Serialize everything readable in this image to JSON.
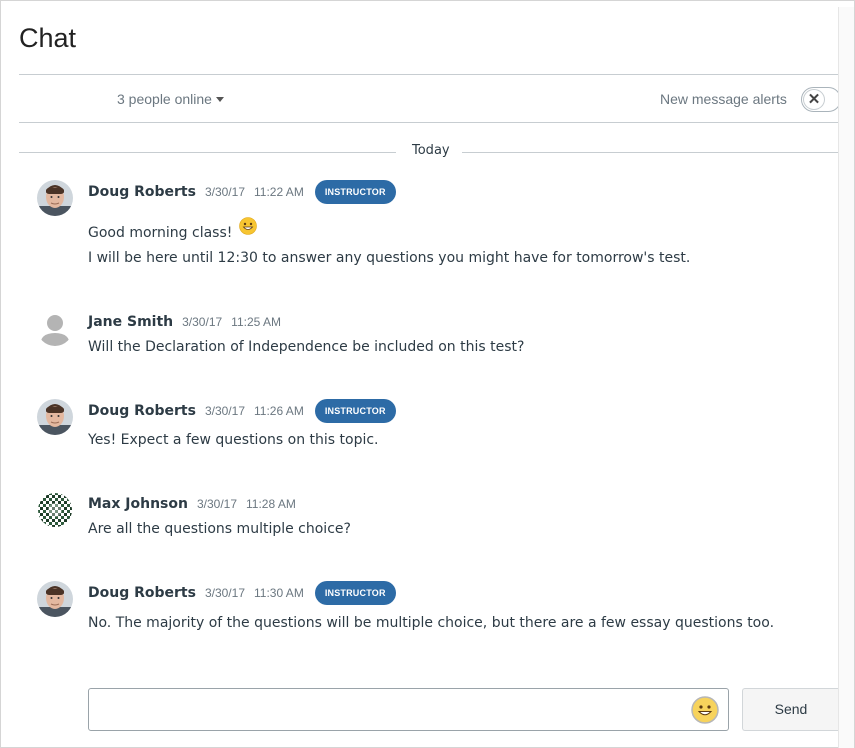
{
  "header": {
    "title": "Chat",
    "online_label": "3 people online",
    "alerts_label": "New message alerts",
    "alerts_toggle_symbol": "✕"
  },
  "divider": {
    "label": "Today"
  },
  "messages": [
    {
      "author": "Doug Roberts",
      "date": "3/30/17",
      "time": "11:22 AM",
      "badge": "INSTRUCTOR",
      "avatar": "photo-avatar",
      "lines": [
        "Good morning class!",
        "I will be here until 12:30 to answer any questions you might have for tomorrow's test."
      ],
      "emoji": "grinning-face-emoji"
    },
    {
      "author": "Jane Smith",
      "date": "3/30/17",
      "time": "11:25 AM",
      "badge": "",
      "avatar": "default-person-avatar",
      "lines": [
        "Will the Declaration of Independence be included on this test?"
      ]
    },
    {
      "author": "Doug Roberts",
      "date": "3/30/17",
      "time": "11:26 AM",
      "badge": "INSTRUCTOR",
      "avatar": "photo-avatar",
      "lines": [
        "Yes! Expect a few questions on this topic."
      ]
    },
    {
      "author": "Max Johnson",
      "date": "3/30/17",
      "time": "11:28 AM",
      "badge": "",
      "avatar": "pattern-avatar",
      "lines": [
        "Are all the questions multiple choice?"
      ]
    },
    {
      "author": "Doug Roberts",
      "date": "3/30/17",
      "time": "11:30 AM",
      "badge": "INSTRUCTOR",
      "avatar": "photo-avatar",
      "lines": [
        "No. The majority of the questions will be multiple choice, but there are a few essay questions too."
      ]
    }
  ],
  "composer": {
    "input_value": "",
    "emoji_icon": "smiley-icon",
    "send_label": "Send"
  },
  "colors": {
    "badge": "#2d6ba6",
    "text": "#2d3b45",
    "muted": "#6b7780"
  }
}
